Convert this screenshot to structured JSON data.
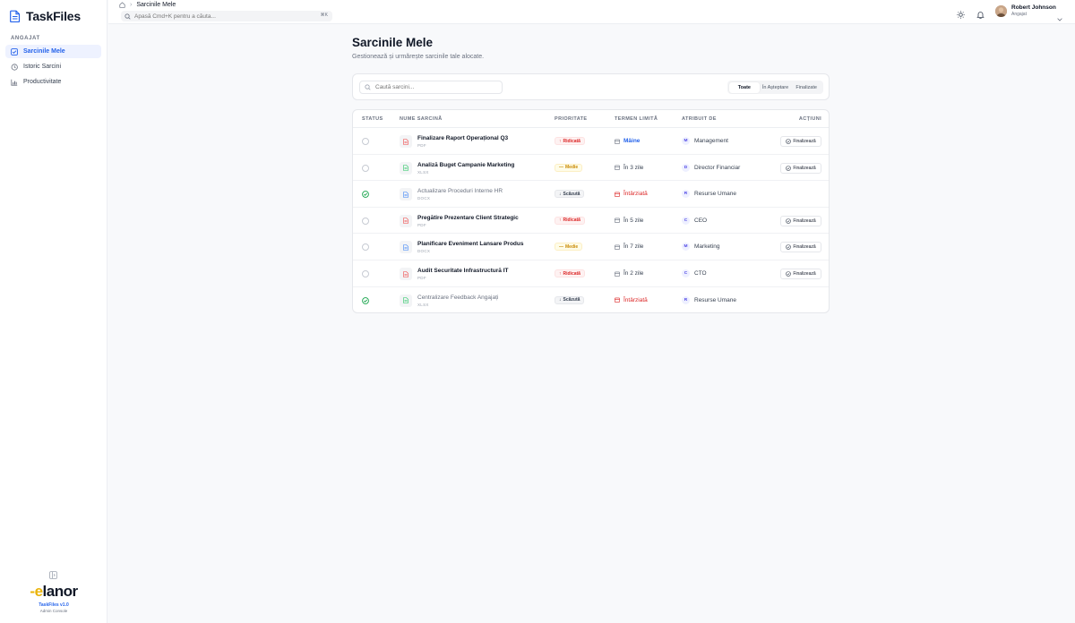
{
  "app": {
    "name": "TaskFiles"
  },
  "sidebar": {
    "section_label": "ANGAJAT",
    "items": [
      {
        "label": "Sarcinile Mele",
        "icon": "checkbox-icon",
        "active": true
      },
      {
        "label": "Istoric Sarcini",
        "icon": "history-icon",
        "active": false
      },
      {
        "label": "Productivitate",
        "icon": "chart-icon",
        "active": false
      }
    ],
    "brand": {
      "version": "TaskFiles v1.0",
      "subtitle": "Admin Console",
      "logo_text": "lanor"
    }
  },
  "header": {
    "breadcrumb": "Sarcinile Mele",
    "search_placeholder": "Apasă Cmd+K pentru a căuta...",
    "kbd": "⌘K",
    "user": {
      "name": "Robert Johnson",
      "role": "Angajat"
    }
  },
  "page": {
    "title": "Sarcinile Mele",
    "subtitle": "Gestionează și urmărește sarcinile tale alocate."
  },
  "filters": {
    "search_placeholder": "Caută sarcini...",
    "tabs": [
      {
        "label": "Toate",
        "active": true
      },
      {
        "label": "În Așteptare",
        "active": false
      },
      {
        "label": "Finalizate",
        "active": false
      }
    ]
  },
  "table": {
    "columns": [
      "STATUS",
      "NUME SARCINĂ",
      "PRIORITATE",
      "TERMEN LIMITĂ",
      "ATRIBUIT DE",
      "ACȚIUNI"
    ],
    "action_label": "Finalizează",
    "rows": [
      {
        "name": "Finalizare Raport Operațional Q3",
        "type": "PDF",
        "priority": "Ridicată",
        "priority_level": "high",
        "deadline": "Mâine",
        "deadline_state": "soon",
        "assignee": "Management",
        "initial": "M",
        "done": false
      },
      {
        "name": "Analiză Buget Campanie Marketing",
        "type": "XLSX",
        "priority": "Medie",
        "priority_level": "med",
        "deadline": "În 3 zile",
        "deadline_state": "normal",
        "assignee": "Director Financiar",
        "initial": "D",
        "done": false
      },
      {
        "name": "Actualizare Proceduri Interne HR",
        "type": "DOCX",
        "priority": "Scăzută",
        "priority_level": "low",
        "deadline": "Întârziată",
        "deadline_state": "late",
        "assignee": "Resurse Umane",
        "initial": "R",
        "done": true
      },
      {
        "name": "Pregătire Prezentare Client Strategic",
        "type": "PDF",
        "priority": "Ridicată",
        "priority_level": "high",
        "deadline": "În 5 zile",
        "deadline_state": "normal",
        "assignee": "CEO",
        "initial": "C",
        "done": false
      },
      {
        "name": "Planificare Eveniment Lansare Produs",
        "type": "DOCX",
        "priority": "Medie",
        "priority_level": "med",
        "deadline": "În 7 zile",
        "deadline_state": "normal",
        "assignee": "Marketing",
        "initial": "M",
        "done": false
      },
      {
        "name": "Audit Securitate Infrastructură IT",
        "type": "PDF",
        "priority": "Ridicată",
        "priority_level": "high",
        "deadline": "În 2 zile",
        "deadline_state": "normal",
        "assignee": "CTO",
        "initial": "C",
        "done": false
      },
      {
        "name": "Centralizare Feedback Angajați",
        "type": "XLSX",
        "priority": "Scăzută",
        "priority_level": "low",
        "deadline": "Întârziată",
        "deadline_state": "late",
        "assignee": "Resurse Umane",
        "initial": "R",
        "done": true
      }
    ]
  },
  "colors": {
    "accent": "#2563eb",
    "danger": "#dc2626",
    "warning": "#ca8a04",
    "success": "#16a34a",
    "pdf": "#ef4444",
    "xlsx": "#22c55e",
    "docx": "#3b82f6"
  }
}
